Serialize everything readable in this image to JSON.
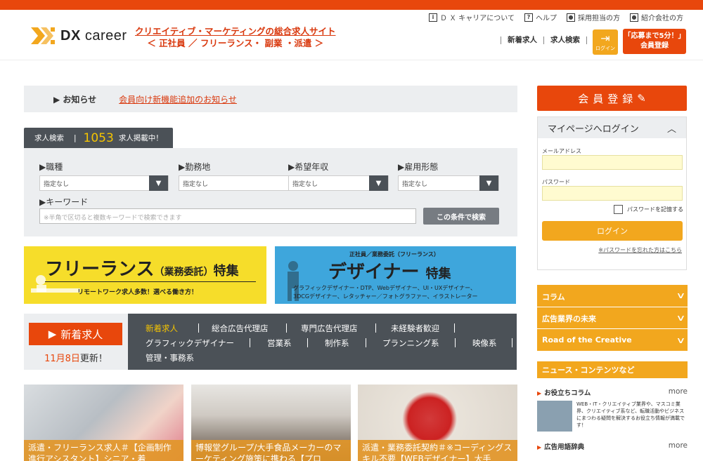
{
  "header": {
    "logo_text": "DX",
    "logo_text2": "career",
    "tagline_line1": "クリエイティブ・マーケティングの総合求人サイト",
    "tagline_line2": "＜ 正社員 ／ フリーランス・ 副業 ・派遣 ＞",
    "top_links": [
      {
        "icon": "info-icon",
        "label": "Ｄ Ｘ キャリアについて"
      },
      {
        "icon": "help-icon",
        "label": "ヘルプ"
      },
      {
        "icon": "person-icon",
        "label": "採用担当の方"
      },
      {
        "icon": "person-icon",
        "label": "紹介会社の方"
      }
    ],
    "nav": [
      "新着求人",
      "求人検索"
    ],
    "login_label": "ログイン",
    "register_line1": "「応募まで5分！」",
    "register_line2": "会員登録"
  },
  "notice": {
    "label": "お知らせ",
    "link": "会員向け新機能追加のお知らせ"
  },
  "search": {
    "tab_label": "求人検索",
    "count": "1053",
    "count_suffix": "求人掲載中！",
    "fields": [
      {
        "label": "▶職種",
        "value": "指定なし"
      },
      {
        "label": "▶勤務地",
        "value": "指定なし"
      },
      {
        "label": "▶希望年収",
        "value": "指定なし"
      },
      {
        "label": "▶雇用形態",
        "value": "指定なし"
      }
    ],
    "keyword_label": "▶キーワード",
    "keyword_placeholder": "※半角で区切ると複数キーワードで検索できます",
    "button": "この条件で検索"
  },
  "banners": {
    "freelance_title": "フリーランス",
    "freelance_paren": "（業務委託）",
    "freelance_suffix": "特集",
    "freelance_sub": "リモートワーク求人多数！選べる働き方！",
    "designer_top": "正社員／業務委託（フリーランス）",
    "designer_title": "デザイナー",
    "designer_suffix": "特集",
    "designer_sub1": "グラフィックデザイナー・DTP、Webデザイナー、UI・UXデザイナー、",
    "designer_sub2": "3DCGデザイナー、レタッチャー／フォトグラファー、イラストレーター"
  },
  "newjobs": {
    "button": "新着求人",
    "date_pre": "11月8日",
    "date_post": "更新！",
    "categories": [
      "新着求人",
      "総合広告代理店",
      "専門広告代理店",
      "未経験者歓迎",
      "グラフィックデザイナー",
      "営業系",
      "制作系",
      "プランニング系",
      "映像系",
      "管理・事務系"
    ]
  },
  "cards": [
    {
      "caption": "派遣・フリーランス求人＃【企画制作進行アシスタント】シニア・着"
    },
    {
      "caption": "博報堂グループ/大手食品メーカーのマーケティング施策に携わる【プロ"
    },
    {
      "caption": "派遣・業務委託契約＃※コーディングスキル不要【WEBデザイナー】大手"
    }
  ],
  "sidebar": {
    "register": "会員登録",
    "login_title": "マイページへログイン",
    "email_label": "メールアドレス",
    "password_label": "パスワード",
    "remember": "パスワードを記憶する",
    "login_button": "ログイン",
    "forgot": "※パスワードを忘れた方はこちら",
    "menu": [
      "コラム",
      "広告業界の未来",
      "Road of the Creative"
    ],
    "news_header": "ニュース・コンテンツなど",
    "section1": "お役立ちコラム",
    "section1_item": "WEB・IT・クリエイティブ業界や、マスコミ業界、クリエイティブ系など、転職活動やビジネスにまつわる疑問を解決するお役立ち情報が満載です！",
    "section2": "広告用語辞典",
    "more": "more"
  },
  "colors": {
    "brand": "#e8470c",
    "accent": "#f2a71e",
    "dark": "#4b5157"
  }
}
